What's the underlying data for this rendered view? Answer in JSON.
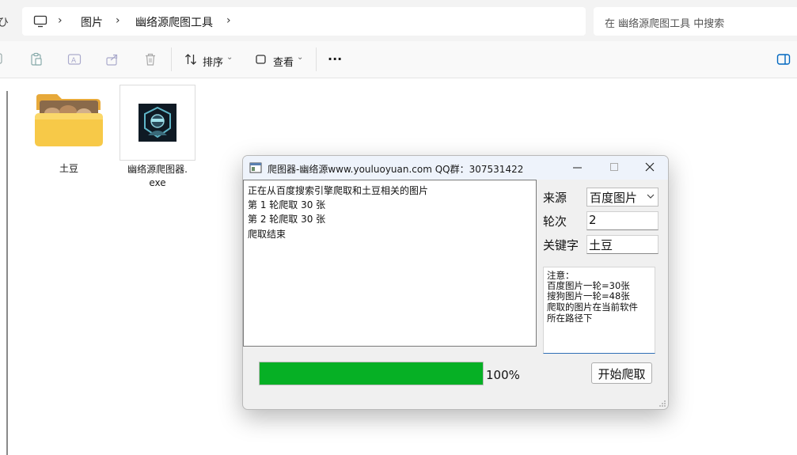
{
  "explorer": {
    "address": {
      "crumbs": [
        "图片",
        "幽络源爬图工具"
      ],
      "left_cut": "ひ"
    },
    "search": {
      "placeholder": "在 幽络源爬图工具 中搜索"
    },
    "toolbar": {
      "sort_label": "排序",
      "view_label": "查看",
      "more_label": "···"
    },
    "files": [
      {
        "name": "土豆",
        "type": "folder"
      },
      {
        "name_line1": "幽络源爬图器.",
        "name_line2": "exe",
        "type": "exe"
      }
    ],
    "colors": {
      "folder": "#f7c948",
      "folder_back": "#e7a93a",
      "accent": "#0067c0"
    }
  },
  "dialog": {
    "title": "爬图器-幽络源www.youluoyuan.com QQ群：307531422",
    "log_lines": [
      "正在从百度搜索引擎爬取和土豆相关的图片",
      "第 1 轮爬取 30 张",
      "第 2 轮爬取 30 张",
      "爬取结束"
    ],
    "source_label": "来源",
    "source_value": "百度图片",
    "rounds_label": "轮次",
    "rounds_value": "2",
    "keyword_label": "关键字",
    "keyword_value": "土豆",
    "notes": [
      "注意：",
      "百度图片一轮=30张",
      "搜狗图片一轮=48张",
      "爬取的图片在当前软件",
      "所在路径下"
    ],
    "progress_fraction": 1.0,
    "progress_text": "100%",
    "start_button": "开始爬取",
    "colors": {
      "progress": "#06b025"
    }
  }
}
